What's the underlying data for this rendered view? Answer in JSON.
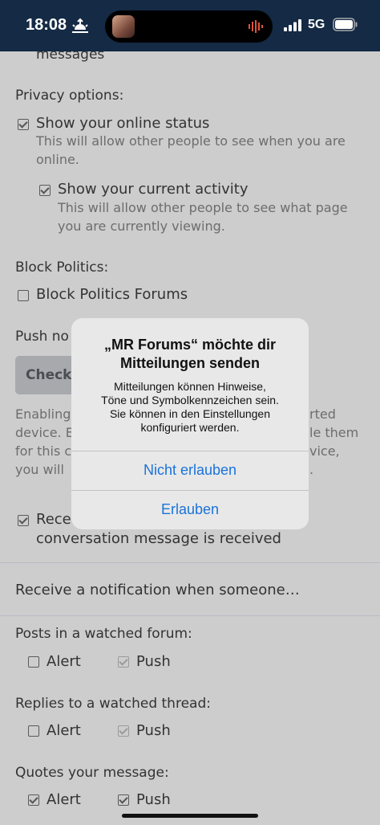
{
  "status_bar": {
    "time": "18:08",
    "network": "5G"
  },
  "page": {
    "cut_off_line": "messages",
    "privacy": {
      "heading": "Privacy options:",
      "online_status": {
        "label": "Show your online status",
        "checked": true,
        "hint_line1": "This will allow other people to see when you are",
        "hint_line2": "online."
      },
      "current_activity": {
        "label": "Show your current activity",
        "checked": true,
        "hint_line1": "This will allow other people to see what page",
        "hint_line2": "you are currently viewing."
      }
    },
    "block_politics": {
      "heading": "Block Politics:",
      "label": "Block Politics Forums",
      "checked": false
    },
    "push": {
      "heading_partial": "Push no",
      "check_button": "Check",
      "desc_left": [
        "Enabling",
        "device. E",
        "for this c",
        "you will"
      ],
      "desc_right": [
        "rted",
        "le them",
        "vice,",
        "."
      ]
    },
    "conversation": {
      "label_partial": "Rece",
      "label_line2": "conversation message is received",
      "checked": true
    },
    "notify_heading": "Receive a notification when someone…",
    "watched_forum": {
      "heading": "Posts in a watched forum:",
      "alert": "Alert",
      "push": "Push",
      "alert_checked": false,
      "push_checked": true
    },
    "watched_thread": {
      "heading": "Replies to a watched thread:",
      "alert": "Alert",
      "push": "Push",
      "alert_checked": false,
      "push_checked": true
    },
    "quotes": {
      "heading": "Quotes your message:",
      "alert": "Alert",
      "push": "Push",
      "alert_checked": true,
      "push_checked": true
    }
  },
  "dialog": {
    "title_line1": "„MR Forums“ möchte dir",
    "title_line2": "Mitteilungen senden",
    "message_line1": "Mitteilungen können Hinweise,",
    "message_line2": "Töne und Symbolkennzeichen sein.",
    "message_line3": "Sie können in den Einstellungen",
    "message_line4": "konfiguriert werden.",
    "deny_button": "Nicht erlauben",
    "allow_button": "Erlauben"
  }
}
